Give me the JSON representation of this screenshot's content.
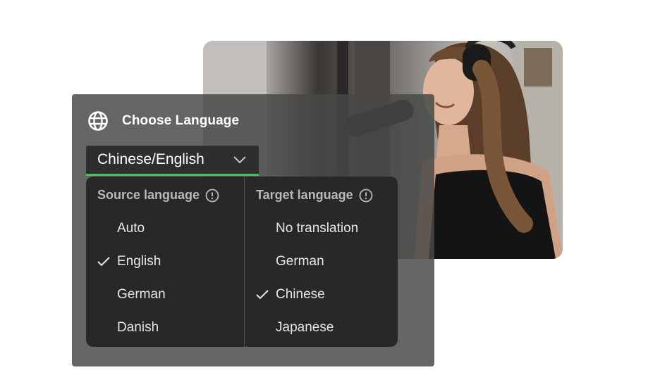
{
  "panel": {
    "title": "Choose Language",
    "selector_value": "Chinese/English",
    "globe_icon": "globe-icon",
    "accent_color": "#3dc25f"
  },
  "source": {
    "header": "Source language",
    "options": [
      {
        "label": "Auto",
        "selected": false
      },
      {
        "label": "English",
        "selected": true
      },
      {
        "label": "German",
        "selected": false
      },
      {
        "label": "Danish",
        "selected": false
      }
    ]
  },
  "target": {
    "header": "Target language",
    "options": [
      {
        "label": "No translation",
        "selected": false
      },
      {
        "label": "German",
        "selected": false
      },
      {
        "label": "Chinese",
        "selected": true
      },
      {
        "label": "Japanese",
        "selected": false
      }
    ]
  }
}
